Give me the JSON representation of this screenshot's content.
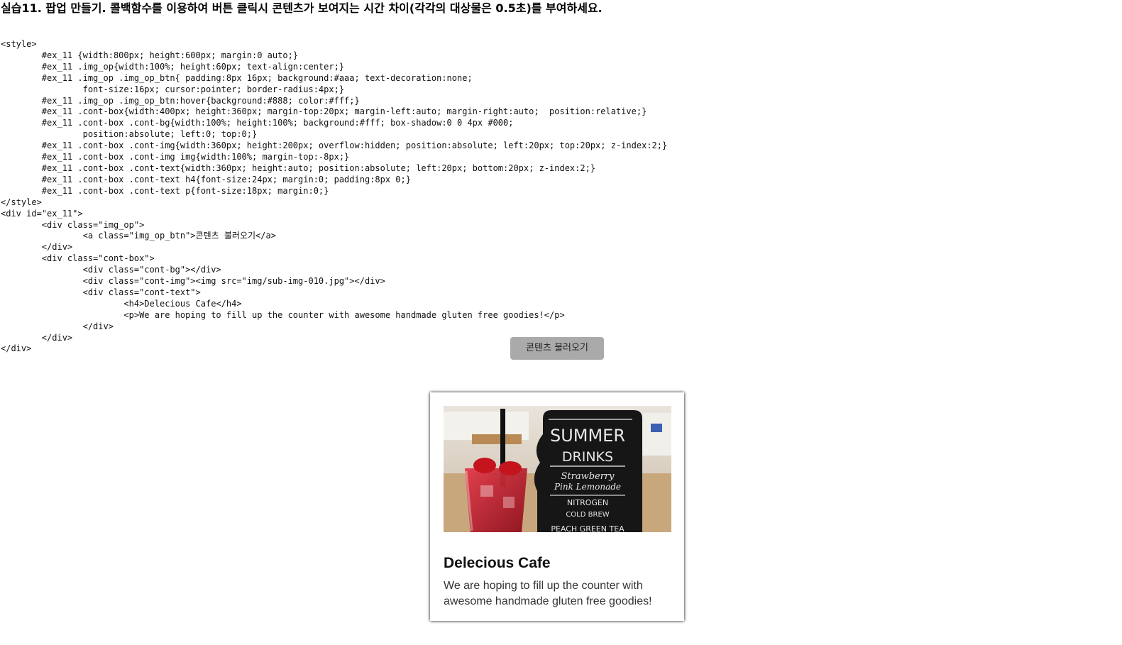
{
  "page": {
    "title": "실습11. 팝업 만들기. 콜백함수를 이용하여 버튼 클릭시 콘텐츠가 보여지는 시간 차이(각각의 대상물은 0.5초)를 부여하세요."
  },
  "code": {
    "lines": [
      "<style>",
      "        #ex_11 {width:800px; height:600px; margin:0 auto;}",
      "        #ex_11 .img_op{width:100%; height:60px; text-align:center;}",
      "        #ex_11 .img_op .img_op_btn{ padding:8px 16px; background:#aaa; text-decoration:none;",
      "                font-size:16px; cursor:pointer; border-radius:4px;}",
      "        #ex_11 .img_op .img_op_btn:hover{background:#888; color:#fff;}",
      "        #ex_11 .cont-box{width:400px; height:360px; margin-top:20px; margin-left:auto; margin-right:auto;  position:relative;}",
      "        #ex_11 .cont-box .cont-bg{width:100%; height:100%; background:#fff; box-shadow:0 0 4px #000;",
      "                position:absolute; left:0; top:0;}",
      "        #ex_11 .cont-box .cont-img{width:360px; height:200px; overflow:hidden; position:absolute; left:20px; top:20px; z-index:2;}",
      "        #ex_11 .cont-box .cont-img img{width:100%; margin-top:-8px;}",
      "        #ex_11 .cont-box .cont-text{width:360px; height:auto; position:absolute; left:20px; bottom:20px; z-index:2;}",
      "        #ex_11 .cont-box .cont-text h4{font-size:24px; margin:0; padding:8px 0;}",
      "        #ex_11 .cont-box .cont-text p{font-size:18px; margin:0;}",
      "</style>",
      "<div id=\"ex_11\">",
      "        <div class=\"img_op\">",
      "                <a class=\"img_op_btn\">콘텐츠 불러오기</a>",
      "        </div>",
      "        <div class=\"cont-box\">",
      "                <div class=\"cont-bg\"></div>",
      "                <div class=\"cont-img\"><img src=\"img/sub-img-010.jpg\"></div>",
      "                <div class=\"cont-text\">",
      "                        <h4>Delecious Cafe</h4>",
      "                        <p>We are hoping to fill up the counter with awesome handmade gluten free goodies!</p>",
      "                </div>",
      "        </div>",
      "</div>"
    ]
  },
  "button": {
    "label": "콘텐츠 불러오기"
  },
  "card": {
    "image": {
      "alt": "",
      "sign_lines": [
        "SUMMER",
        "DRINKS",
        "Strawberry",
        "Pink Lemonade",
        "NITROGEN",
        "COLD BREW",
        "PEACH GREEN TEA"
      ]
    },
    "heading": "Delecious Cafe",
    "body": "We are hoping to fill up the counter with awesome handmade gluten free goodies!"
  },
  "colors": {
    "button_bg": "#aaaaaa",
    "button_hover_bg": "#888888",
    "card_bg": "#ffffff"
  }
}
